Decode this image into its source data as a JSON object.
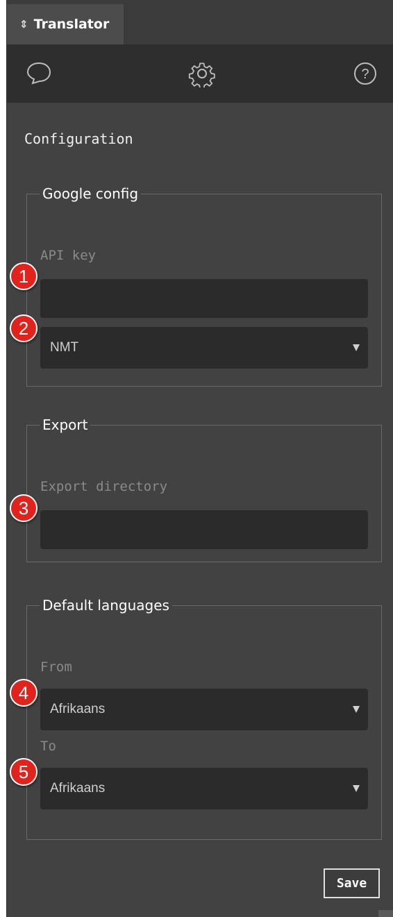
{
  "tab": {
    "title": "Translator",
    "icon": "sort-icon"
  },
  "toolbar": {
    "items": [
      {
        "name": "chat-icon"
      },
      {
        "name": "gear-icon"
      },
      {
        "name": "help-icon"
      }
    ]
  },
  "config": {
    "heading": "Configuration",
    "google": {
      "legend": "Google config",
      "api_key_label": "API key",
      "api_key_value": "",
      "model_value": "NMT"
    },
    "export": {
      "legend": "Export",
      "dir_label": "Export directory",
      "dir_value": ""
    },
    "languages": {
      "legend": "Default languages",
      "from_label": "From",
      "from_value": "Afrikaans",
      "to_label": "To",
      "to_value": "Afrikaans"
    },
    "save_label": "Save"
  },
  "annotations": [
    "1",
    "2",
    "3",
    "4",
    "5"
  ],
  "colors": {
    "badge": "#e0231c",
    "panel": "#424242",
    "toolbar": "#2e2e2e",
    "field": "#2b2b2b"
  }
}
